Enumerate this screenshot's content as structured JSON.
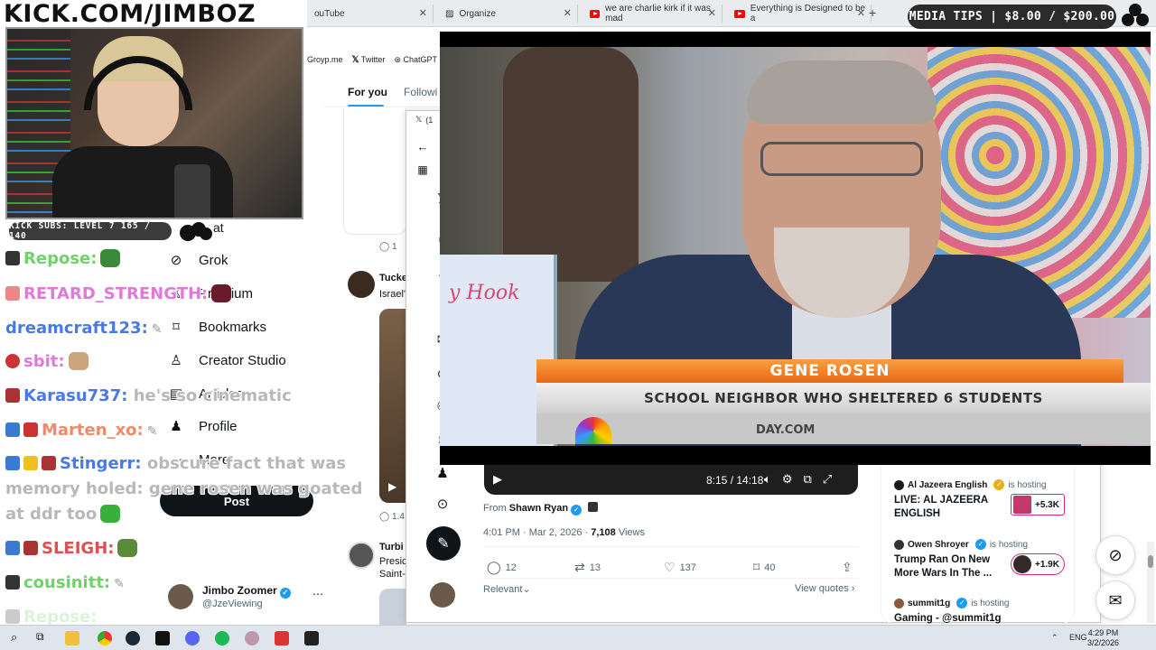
{
  "stream": {
    "channel_title": "KICK.COM/JIMBOZ",
    "subs_badge": "KICK SUBS: LEVEL 7 165 / 140",
    "media_tips": "MEDIA TIPS | $8.00 / $200.00"
  },
  "browser": {
    "tabs": [
      {
        "label": "ouTube"
      },
      {
        "label": "Organize"
      },
      {
        "label": "we are charlie kirk if it was mad"
      },
      {
        "label": "Everything is Designed to be a"
      }
    ],
    "bookmarks": [
      {
        "label": "Groyp.me"
      },
      {
        "label": "Twitter"
      },
      {
        "label": "ChatGPT"
      }
    ]
  },
  "chat": [
    {
      "user": "Repose:",
      "message": "",
      "color": "#6fd36a"
    },
    {
      "user": "RETARD_STRENGTH:",
      "message": "",
      "color": "#e07ad8"
    },
    {
      "user": "dreamcraft123:",
      "message": "",
      "color": "#4a7ae0"
    },
    {
      "user": "sbit:",
      "message": "",
      "color": "#e07ad8"
    },
    {
      "user": "Karasu737:",
      "message": "he's so cinematic",
      "color": "#4a7ae0"
    },
    {
      "user": "Marten_xo:",
      "message": "",
      "color": "#f08a6a"
    },
    {
      "user": "Stingerr:",
      "message": "obscure fact that was",
      "color": "#4a7ae0"
    },
    {
      "user": "",
      "message": "memory holed: gene rosen was goated",
      "color": "#b8b8b8"
    },
    {
      "user": "",
      "message": "at ddr too",
      "color": "#b8b8b8"
    },
    {
      "user": "SLEIGH:",
      "message": "",
      "color": "#e05050"
    },
    {
      "user": "cousinitt:",
      "message": "",
      "color": "#6fd36a"
    },
    {
      "user": "Repose:",
      "message": "",
      "color": "#6fd36a"
    }
  ],
  "x_nav": {
    "items": [
      {
        "label": "Grok",
        "icon": "grok-icon"
      },
      {
        "label": "Premium",
        "icon": "premium-icon"
      },
      {
        "label": "Bookmarks",
        "icon": "bookmark-icon"
      },
      {
        "label": "Creator Studio",
        "icon": "creator-studio-icon"
      },
      {
        "label": "Articles",
        "icon": "articles-icon"
      },
      {
        "label": "Profile",
        "icon": "profile-icon"
      },
      {
        "label": "More",
        "icon": "more-icon"
      }
    ],
    "partial_top_label": "at",
    "post_button": "Post",
    "account": {
      "name": "Jimbo Zoomer",
      "handle": "@JzeViewing"
    }
  },
  "timeline": {
    "tab_for_you": "For you",
    "tab_following": "Followi",
    "reply_count_1": "1",
    "author_1": "Tucke",
    "text_1": "Israel'",
    "reply_count_2": "1.4",
    "author_2": "Turbi",
    "text_2a": "Presic",
    "text_2b": "Saint-"
  },
  "popup": {
    "tab_label": "(1"
  },
  "video": {
    "lower_third_name": "GENE ROSEN",
    "lower_third_title": "SCHOOL NEIGHBOR WHO SHELTERED 6 STUDENTS",
    "lower_third_web": "DAY.COM",
    "sign_text": "y Hook",
    "time": "8:15 / 14:18"
  },
  "post": {
    "from_label": "From",
    "from_name": "Shawn Ryan",
    "time": "4:01 PM · Mar 2, 2026 ·",
    "views_count": "7,108",
    "views_label": "Views",
    "replies": "12",
    "reposts": "13",
    "likes": "137",
    "bookmarks": "40",
    "relevant": "Relevant",
    "view_quotes": "View quotes"
  },
  "live": [
    {
      "host": "Al Jazeera English",
      "status": "is hosting",
      "title": "LIVE: AL JAZEERA ENGLISH",
      "count": "+5.3K"
    },
    {
      "host": "Owen Shroyer",
      "status": "is hosting",
      "title": "Trump Ran On New More Wars In The ...",
      "count": "+1.9K"
    },
    {
      "host": "summit1g",
      "status": "is hosting",
      "title": "Gaming - @summit1g",
      "count": ""
    }
  ],
  "taskbar": {
    "lang": "ENG",
    "time": "4:29 PM",
    "date": "3/2/2026"
  },
  "colors": {
    "x_blue": "#1d9bf0",
    "live_pink": "#e0287a",
    "lower_third_orange": "#e86818"
  }
}
